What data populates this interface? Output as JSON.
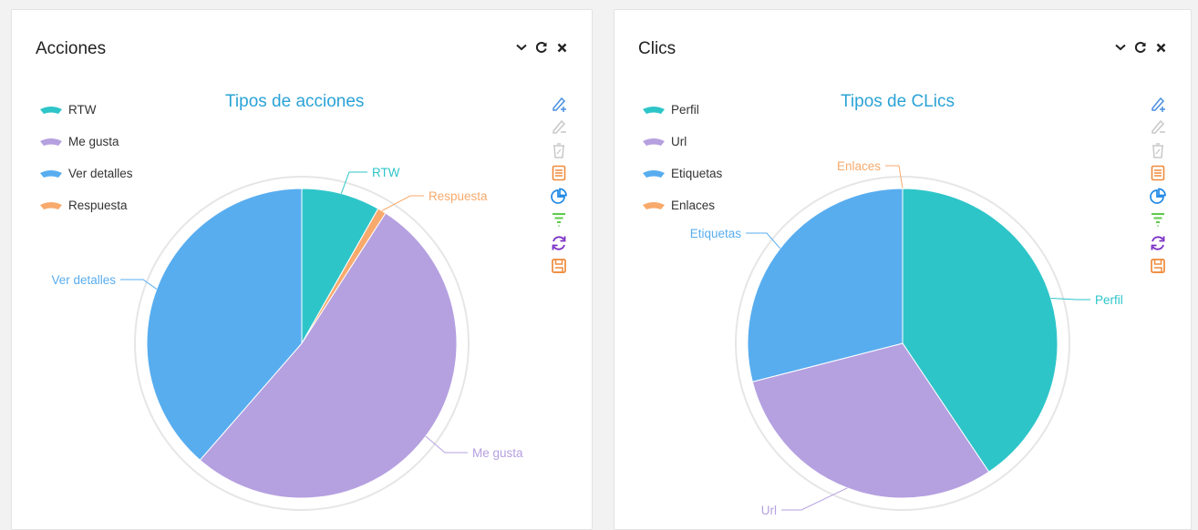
{
  "colors": {
    "teal": "#2ec5c9",
    "purple": "#b5a0e0",
    "blue": "#58adef",
    "orange": "#f8aa6c",
    "title_blue": "#2ba3d6"
  },
  "panels": [
    {
      "title": "Acciones",
      "controls": [
        "chevron-down-icon",
        "refresh-icon",
        "close-icon"
      ],
      "legend": [
        "RTW",
        "Me gusta",
        "Ver detalles",
        "Respuesta"
      ],
      "toolbox": [
        "edit-add-icon",
        "edit-remove-icon",
        "trash-icon",
        "data-view-icon",
        "pie-chart-icon",
        "funnel-icon",
        "restore-icon",
        "save-icon"
      ]
    },
    {
      "title": "Clics",
      "controls": [
        "chevron-down-icon",
        "refresh-icon",
        "close-icon"
      ],
      "legend": [
        "Perfil",
        "Url",
        "Etiquetas",
        "Enlaces"
      ],
      "toolbox": [
        "edit-add-icon",
        "edit-remove-icon",
        "trash-icon",
        "data-view-icon",
        "pie-chart-icon",
        "funnel-icon",
        "restore-icon",
        "save-icon"
      ]
    }
  ],
  "chart_data": [
    {
      "type": "pie",
      "title": "Tipos de acciones",
      "categories": [
        "RTW",
        "Respuesta",
        "Me gusta",
        "Ver detalles"
      ],
      "values": [
        8.2,
        0.9,
        52.3,
        38.6
      ],
      "unit": "percent (estimated share of the circle)",
      "colors": [
        "#2ec5c9",
        "#f8aa6c",
        "#b5a0e0",
        "#58adef"
      ],
      "legend_placement": "top-left"
    },
    {
      "type": "pie",
      "title": "Tipos de CLics",
      "categories": [
        "Enlaces",
        "Perfil",
        "Url",
        "Etiquetas"
      ],
      "values": [
        0.0,
        40.6,
        30.4,
        29.0
      ],
      "unit": "percent (estimated share of the circle)",
      "colors": [
        "#f8aa6c",
        "#2ec5c9",
        "#b5a0e0",
        "#58adef"
      ],
      "legend_placement": "top-left"
    }
  ]
}
